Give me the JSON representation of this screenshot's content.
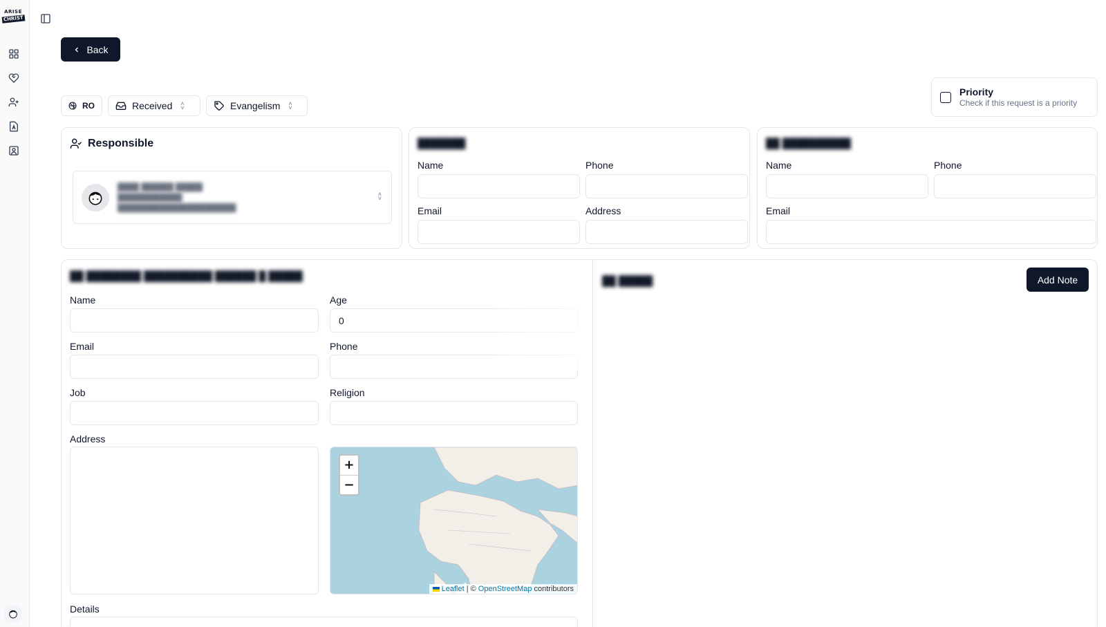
{
  "app": {
    "logo_line1": "ARISE",
    "logo_line2": "CHRIST"
  },
  "sidebar": {
    "items": [
      {
        "icon": "dashboard-icon"
      },
      {
        "icon": "heart-handshake-icon"
      },
      {
        "icon": "user-plus-icon"
      },
      {
        "icon": "document-icon"
      },
      {
        "icon": "contact-icon"
      }
    ]
  },
  "toolbar": {
    "back_label": "Back"
  },
  "chips": {
    "language": "RO",
    "status": "Received",
    "category": "Evangelism"
  },
  "priority": {
    "title": "Priority",
    "subtitle": "Check if this request is a priority",
    "checked": false
  },
  "responsible": {
    "title": "Responsible",
    "line1": "████ ██████ █████",
    "line2": "████████████",
    "line3": "██████████████████████"
  },
  "contact_b": {
    "title": "███████",
    "name_label": "Name",
    "phone_label": "Phone",
    "email_label": "Email",
    "address_label": "Address"
  },
  "contact_c": {
    "title": "██ ██████████",
    "name_label": "Name",
    "phone_label": "Phone",
    "email_label": "Email"
  },
  "person": {
    "title": "██ ████████ ██████████ ██████ █ █████",
    "name_label": "Name",
    "age_label": "Age",
    "age_value": "0",
    "email_label": "Email",
    "phone_label": "Phone",
    "job_label": "Job",
    "religion_label": "Religion",
    "address_label": "Address",
    "details_label": "Details"
  },
  "map": {
    "zoom_in": "+",
    "zoom_out": "−",
    "attr_leaflet": "Leaflet",
    "attr_sep": "| ©",
    "attr_osm": "OpenStreetMap",
    "attr_contrib": "contributors"
  },
  "notes": {
    "title": "██ █████",
    "add_note_label": "Add Note"
  }
}
